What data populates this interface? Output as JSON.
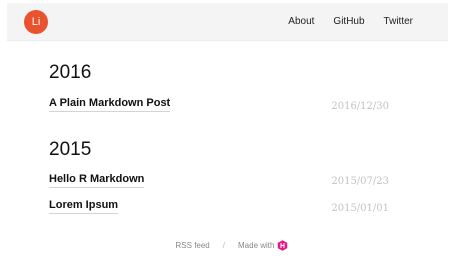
{
  "header": {
    "logo_text": "Li",
    "nav": [
      {
        "label": "About"
      },
      {
        "label": "GitHub"
      },
      {
        "label": "Twitter"
      }
    ]
  },
  "archive": [
    {
      "year": "2016",
      "posts": [
        {
          "title": "A Plain Markdown Post",
          "date": "2016/12/30"
        }
      ]
    },
    {
      "year": "2015",
      "posts": [
        {
          "title": "Hello R Markdown",
          "date": "2015/07/23"
        },
        {
          "title": "Lorem Ipsum",
          "date": "2015/01/01"
        }
      ]
    }
  ],
  "footer": {
    "rss_label": "RSS feed",
    "separator": "/",
    "made_with_label": "Made with",
    "made_with_icon": "hugo-logo-icon"
  },
  "colors": {
    "logo_bg": "#e8522f",
    "made_with_icon": "#e6198c",
    "date_text": "#c2c2c2"
  }
}
